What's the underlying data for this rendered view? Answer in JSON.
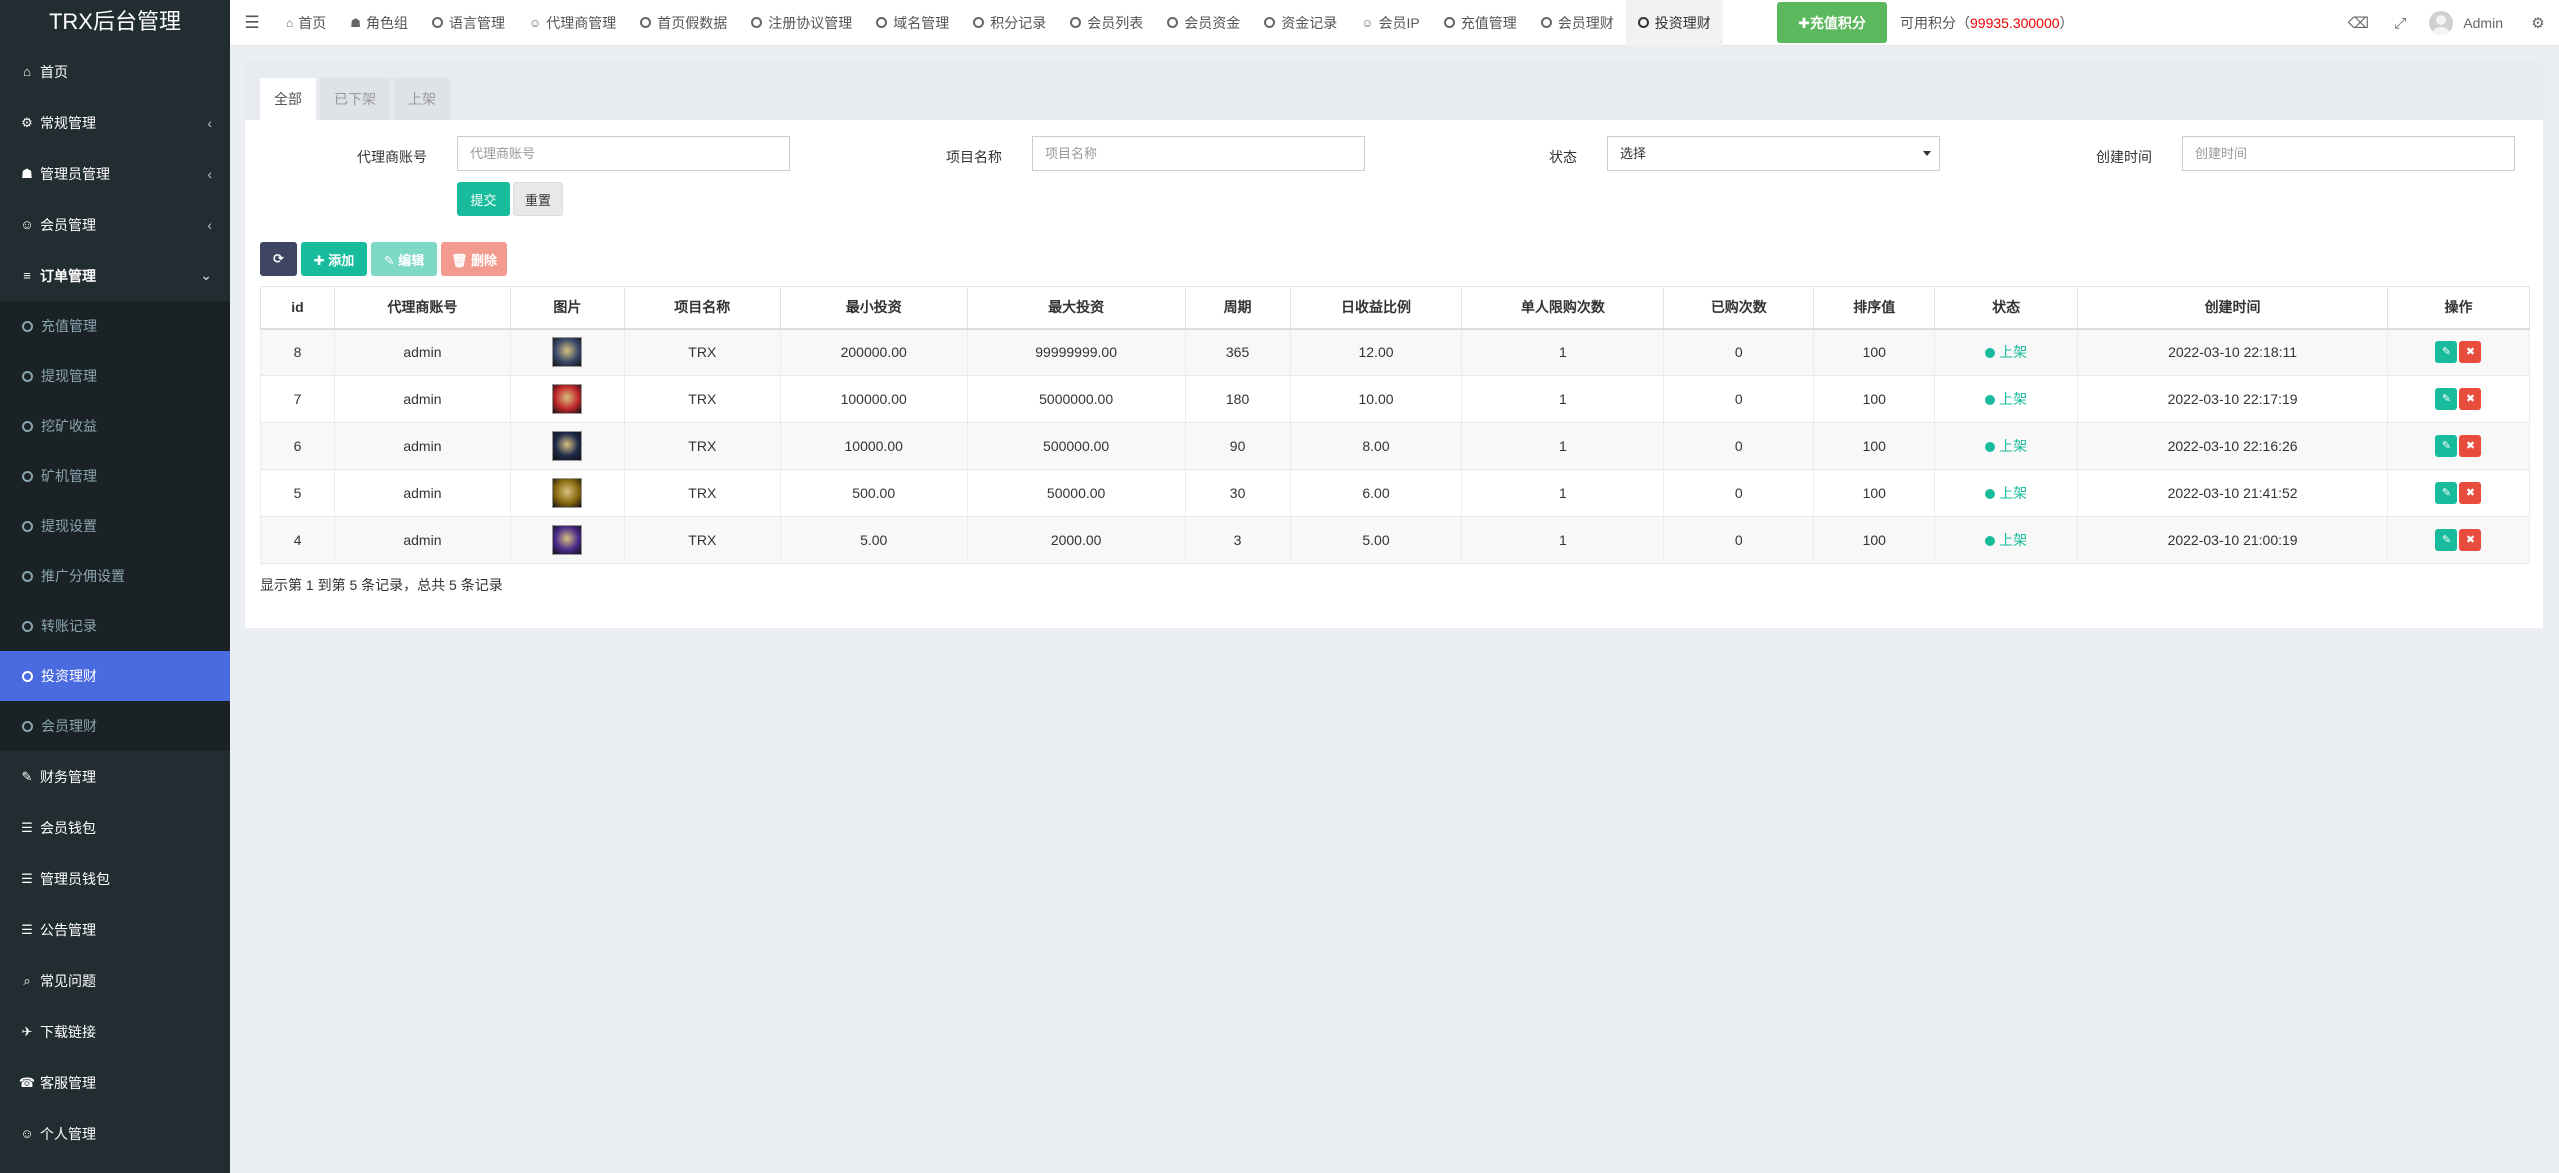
{
  "app": {
    "title": "TRX后台管理"
  },
  "sidebar": {
    "items_top": [
      {
        "icon": "⌂",
        "label": "首页"
      },
      {
        "icon": "⚙",
        "label": "常规管理",
        "caret": "‹"
      },
      {
        "icon": "☗",
        "label": "管理员管理",
        "caret": "‹"
      },
      {
        "icon": "☺",
        "label": "会员管理",
        "caret": "‹"
      },
      {
        "icon": "≡",
        "label": "订单管理",
        "caret": "⌄"
      }
    ],
    "sub_items": [
      "充值管理",
      "提现管理",
      "挖矿收益",
      "矿机管理",
      "提现设置",
      "推广分佣设置",
      "转账记录",
      "投资理财",
      "会员理财"
    ],
    "items_bottom": [
      {
        "icon": "✎",
        "label": "财务管理"
      },
      {
        "icon": "☰",
        "label": "会员钱包"
      },
      {
        "icon": "☰",
        "label": "管理员钱包"
      },
      {
        "icon": "☰",
        "label": "公告管理"
      },
      {
        "icon": "⌕",
        "label": "常见问题"
      },
      {
        "icon": "✈",
        "label": "下载链接"
      },
      {
        "icon": "☎",
        "label": "客服管理"
      },
      {
        "icon": "☺",
        "label": "个人管理"
      }
    ]
  },
  "topbar": {
    "tabs": [
      {
        "icon": "⌂",
        "label": "首页"
      },
      {
        "icon": "☗",
        "label": "角色组"
      },
      {
        "icon": "",
        "label": "语言管理"
      },
      {
        "icon": "☺",
        "label": "代理商管理"
      },
      {
        "icon": "",
        "label": "首页假数据"
      },
      {
        "icon": "",
        "label": "注册协议管理"
      },
      {
        "icon": "",
        "label": "域名管理"
      },
      {
        "icon": "",
        "label": "积分记录"
      },
      {
        "icon": "",
        "label": "会员列表"
      },
      {
        "icon": "",
        "label": "会员资金"
      },
      {
        "icon": "",
        "label": "资金记录"
      },
      {
        "icon": "☺",
        "label": "会员IP"
      },
      {
        "icon": "",
        "label": "充值管理"
      },
      {
        "icon": "",
        "label": "会员理财"
      },
      {
        "icon": "",
        "label": "投资理财"
      }
    ],
    "recharge_label": "✚充值积分",
    "points_label": "可用积分（",
    "points_value": "99935.300000",
    "points_close": "）",
    "user_name": "Admin"
  },
  "panel": {
    "tabs": [
      "全部",
      "已下架",
      "上架"
    ],
    "filters": {
      "agent_label": "代理商账号",
      "agent_placeholder": "代理商账号",
      "project_label": "项目名称",
      "project_placeholder": "项目名称",
      "status_label": "状态",
      "status_value": "选择",
      "created_label": "创建时间",
      "created_placeholder": "创建时间"
    },
    "submit_label": "提交",
    "reset_label": "重置",
    "toolbar": {
      "refresh": "⟳",
      "add": "✚ 添加",
      "edit": "✎ 编辑",
      "delete": "🗑 删除"
    },
    "columns": [
      "id",
      "代理商账号",
      "图片",
      "项目名称",
      "最小投资",
      "最大投资",
      "周期",
      "日收益比例",
      "单人限购次数",
      "已购次数",
      "排序值",
      "状态",
      "创建时间",
      "操作"
    ],
    "rows": [
      {
        "id": "8",
        "agent": "admin",
        "thumb_color": "#3a4a6b",
        "name": "TRX",
        "min": "200000.00",
        "max": "99999999.00",
        "period": "365",
        "ratio": "12.00",
        "limit": "1",
        "bought": "0",
        "sort": "100",
        "status": "上架",
        "created": "2022-03-10 22:18:11"
      },
      {
        "id": "7",
        "agent": "admin",
        "thumb_color": "#c0282a",
        "name": "TRX",
        "min": "100000.00",
        "max": "5000000.00",
        "period": "180",
        "ratio": "10.00",
        "limit": "1",
        "bought": "0",
        "sort": "100",
        "status": "上架",
        "created": "2022-03-10 22:17:19"
      },
      {
        "id": "6",
        "agent": "admin",
        "thumb_color": "#1d2a4a",
        "name": "TRX",
        "min": "10000.00",
        "max": "500000.00",
        "period": "90",
        "ratio": "8.00",
        "limit": "1",
        "bought": "0",
        "sort": "100",
        "status": "上架",
        "created": "2022-03-10 22:16:26"
      },
      {
        "id": "5",
        "agent": "admin",
        "thumb_color": "#8a6a10",
        "name": "TRX",
        "min": "500.00",
        "max": "50000.00",
        "period": "30",
        "ratio": "6.00",
        "limit": "1",
        "bought": "0",
        "sort": "100",
        "status": "上架",
        "created": "2022-03-10 21:41:52"
      },
      {
        "id": "4",
        "agent": "admin",
        "thumb_color": "#4a2a8a",
        "name": "TRX",
        "min": "5.00",
        "max": "2000.00",
        "period": "3",
        "ratio": "5.00",
        "limit": "1",
        "bought": "0",
        "sort": "100",
        "status": "上架",
        "created": "2022-03-10 21:00:19"
      }
    ],
    "summary": "显示第 1 到第 5 条记录，总共 5 条记录"
  },
  "colors": {
    "sidebar_bg": "#222d32",
    "active_item": "#4a6ae0",
    "primary": "#18bc9c",
    "danger": "#e74c3c",
    "recharge": "#5cb85c",
    "points": "#ee0000"
  }
}
